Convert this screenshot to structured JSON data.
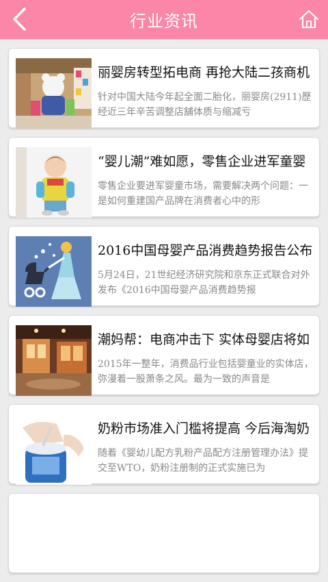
{
  "header": {
    "title": "行业资讯",
    "back_icon": "chevron-left-icon",
    "home_icon": "home-icon",
    "color": "#fb86a8"
  },
  "articles": [
    {
      "title": "丽婴房转型拓电商 再抢大陆二孩商机",
      "summary": "针对中国大陆今年起全面二胎化，丽婴房(2911)歷经近三年辛苦调整店舖体质与缩减亏"
    },
    {
      "title": "“婴儿潮”难如愿，零售企业进军童婴",
      "summary": "零售企业要进军婴童市场，需要解决两个问题：一是如何重建国产品牌在消费者心中的形"
    },
    {
      "title": "2016中国母婴产品消费趋势报告公布",
      "summary": "5月24日，21世纪经济研究院和京东正式联合对外发布《2016中国母婴产品消费趋势报"
    },
    {
      "title": "潮妈帮：电商冲击下 实体母婴店将如",
      "summary": "2015年一整年，消费品行业包括婴童业的实体店，弥漫着一股萧条之风。最为一致的声音是"
    },
    {
      "title": "奶粉市场准入门槛将提高 今后海淘奶",
      "summary": "随着《婴幼儿配方乳粉产品配方注册管理办法》提交至WTO，奶粉注册制的正式实施已为"
    }
  ]
}
